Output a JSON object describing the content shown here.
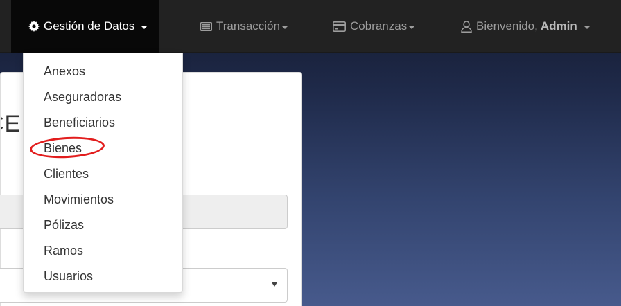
{
  "navbar": {
    "items": [
      {
        "label": "Gestión de Datos",
        "icon": "gear-icon",
        "active": true,
        "has_caret": true
      },
      {
        "label": "Transacción",
        "icon": "list-icon",
        "active": false,
        "has_caret": true
      },
      {
        "label": "Cobranzas",
        "icon": "credit-card-icon",
        "active": false,
        "has_caret": true
      }
    ],
    "user_menu": {
      "greeting": "Bienvenido,",
      "username": "Admin",
      "icon": "user-icon"
    }
  },
  "card": {
    "heading_visible": "CE"
  },
  "dropdown": {
    "items": [
      {
        "label": "Anexos"
      },
      {
        "label": "Aseguradoras"
      },
      {
        "label": "Beneficiarios"
      },
      {
        "label": "Bienes",
        "highlighted": true
      },
      {
        "label": "Clientes"
      },
      {
        "label": "Movimientos"
      },
      {
        "label": "Pólizas"
      },
      {
        "label": "Ramos"
      },
      {
        "label": "Usuarios"
      }
    ]
  },
  "colors": {
    "navbar_bg": "#222222",
    "navbar_active_bg": "#080808",
    "nav_text": "#9d9d9d",
    "highlight_circle": "#e21d1d",
    "background_top": "#141a2e",
    "background_bottom": "#475a8c"
  }
}
